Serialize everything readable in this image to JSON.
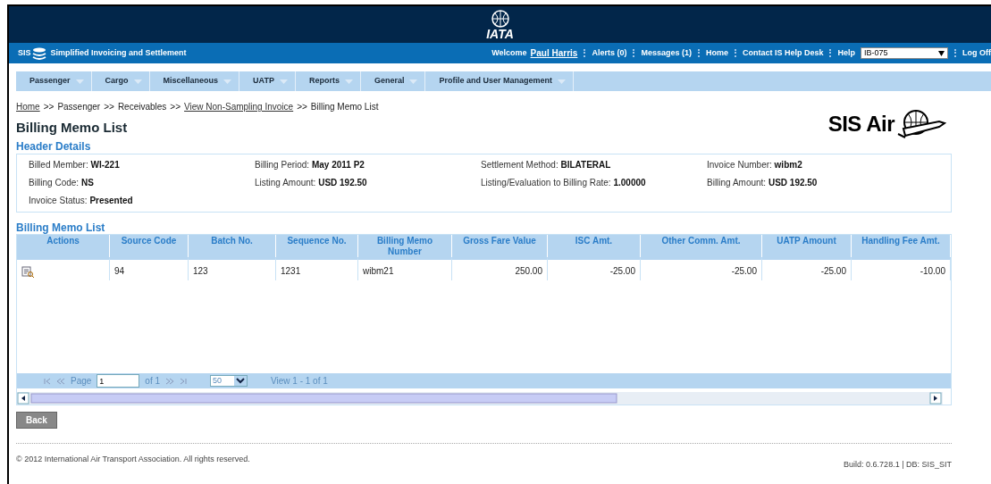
{
  "brand": {
    "logo_text": "IATA",
    "app_short": "SIS",
    "app_title": "Simplified Invoicing and Settlement"
  },
  "user_bar": {
    "welcome": "Welcome",
    "user": "Paul Harris",
    "links": [
      "Alerts (0)",
      "Messages (1)",
      "Home",
      "Contact IS Help Desk",
      "Help"
    ],
    "member_select": "IB-075",
    "logoff": "Log Off"
  },
  "menu": [
    {
      "label": "Passenger"
    },
    {
      "label": "Cargo"
    },
    {
      "label": "Miscellaneous"
    },
    {
      "label": "UATP"
    },
    {
      "label": "Reports"
    },
    {
      "label": "General"
    },
    {
      "label": "Profile and User Management"
    }
  ],
  "breadcrumb": [
    {
      "label": "Home",
      "link": true
    },
    {
      "label": "Passenger",
      "link": false
    },
    {
      "label": "Receivables",
      "link": false
    },
    {
      "label": "View Non-Sampling Invoice",
      "link": true
    },
    {
      "label": "Billing Memo List",
      "link": false
    }
  ],
  "breadcrumb_separator": ">>",
  "page_title": "Billing Memo List",
  "side_logo": "SIS Air",
  "header_details": {
    "title": "Header Details",
    "fields": [
      {
        "label": "Billed Member:",
        "value": "WI-221"
      },
      {
        "label": "Billing Period:",
        "value": "May 2011 P2"
      },
      {
        "label": "Settlement Method:",
        "value": "BILATERAL"
      },
      {
        "label": "Invoice Number:",
        "value": "wibm2"
      },
      {
        "label": "Billing Code:",
        "value": "NS"
      },
      {
        "label": "Listing Amount:",
        "value": "USD 192.50"
      },
      {
        "label": "Listing/Evaluation to Billing Rate:",
        "value": "1.00000"
      },
      {
        "label": "Billing Amount:",
        "value": "USD 192.50"
      },
      {
        "label": "Invoice Status:",
        "value": "Presented"
      }
    ]
  },
  "grid": {
    "title": "Billing Memo List",
    "columns": [
      {
        "label": "Actions",
        "kind": "action"
      },
      {
        "label": "Source Code",
        "kind": "text"
      },
      {
        "label": "Batch No.",
        "kind": "text"
      },
      {
        "label": "Sequence No.",
        "kind": "text"
      },
      {
        "label": "Billing Memo Number",
        "kind": "text"
      },
      {
        "label": "Gross Fare Value",
        "kind": "amount"
      },
      {
        "label": "ISC Amt.",
        "kind": "amount"
      },
      {
        "label": "Other Comm. Amt.",
        "kind": "amount"
      },
      {
        "label": "UATP Amount",
        "kind": "amount"
      },
      {
        "label": "Handling Fee Amt.",
        "kind": "amount"
      }
    ],
    "rows": [
      [
        "",
        "94",
        "123",
        "1231",
        "wibm21",
        "250.00",
        "-25.00",
        "-25.00",
        "-25.00",
        "-10.00"
      ]
    ],
    "pager": {
      "page_label": "Page",
      "page": "1",
      "of": "of 1",
      "page_size": "50",
      "view": "View 1 - 1 of 1"
    }
  },
  "buttons": [
    "Back"
  ],
  "footer": {
    "copyright": "© 2012 International Air Transport Association. All rights reserved.",
    "build": "Build: 0.6.728.1 | DB: SIS_SIT"
  }
}
